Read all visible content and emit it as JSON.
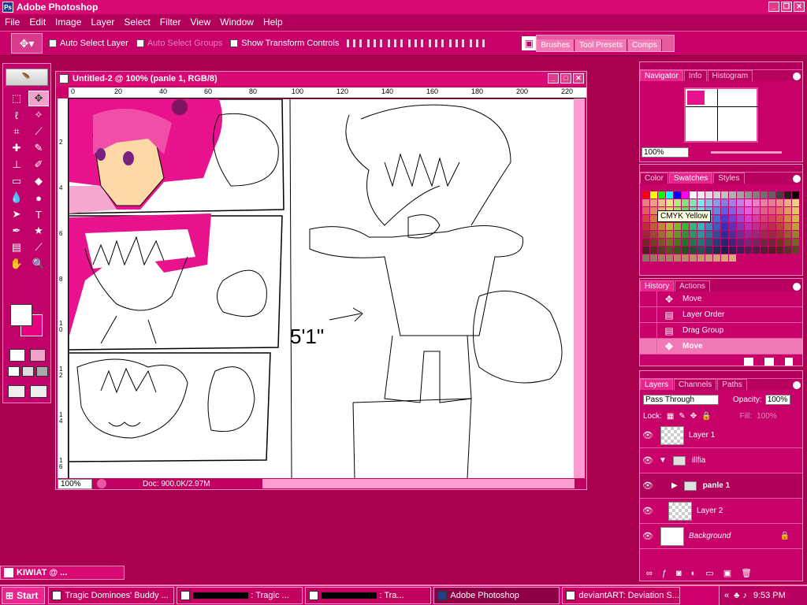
{
  "app": {
    "title": "Adobe Photoshop"
  },
  "menu": [
    "File",
    "Edit",
    "Image",
    "Layer",
    "Select",
    "Filter",
    "View",
    "Window",
    "Help"
  ],
  "options": {
    "auto_select_layer": "Auto Select Layer",
    "auto_select_groups": "Auto Select Groups",
    "show_transform": "Show Transform Controls"
  },
  "palette_well": [
    "Brushes",
    "Tool Presets",
    "Comps"
  ],
  "document": {
    "title": "Untitled-2 @ 100% (panle 1, RGB/8)",
    "zoom": "100%",
    "doc_info": "Doc: 900.0K/2.97M",
    "ruler_h": [
      "0",
      "20",
      "40",
      "60",
      "80",
      "100",
      "120",
      "140",
      "160",
      "180",
      "200",
      "220"
    ],
    "ruler_v": [
      "2",
      "4",
      "6",
      "8",
      "10",
      "12",
      "14",
      "16"
    ],
    "sketch_text": "5'1\""
  },
  "navigator": {
    "tabs": [
      "Navigator",
      "Info",
      "Histogram"
    ],
    "zoom": "100%"
  },
  "swatches": {
    "tabs": [
      "Color",
      "Swatches",
      "Styles"
    ],
    "tooltip": "CMYK Yellow"
  },
  "history": {
    "tabs": [
      "History",
      "Actions"
    ],
    "items": [
      "Move",
      "Layer Order",
      "Drag Group",
      "Move"
    ]
  },
  "layers": {
    "tabs": [
      "Layers",
      "Channels",
      "Paths"
    ],
    "blend_mode": "Pass Through",
    "opacity_label": "Opacity:",
    "opacity": "100%",
    "lock_label": "Lock:",
    "fill_label": "Fill:",
    "fill": "100%",
    "items": [
      "Layer 1",
      "illfia",
      "panle 1",
      "Layer 2",
      "Background"
    ]
  },
  "minidoc": {
    "title": "KIWIAT @ ..."
  },
  "taskbar": {
    "start": "Start",
    "buttons": [
      "Tragic Dominoes' Buddy ...",
      ": Tragic ...",
      ": Tra...",
      "Adobe Photoshop",
      "deviantART: Deviation S..."
    ],
    "clock": "9:53 PM"
  }
}
